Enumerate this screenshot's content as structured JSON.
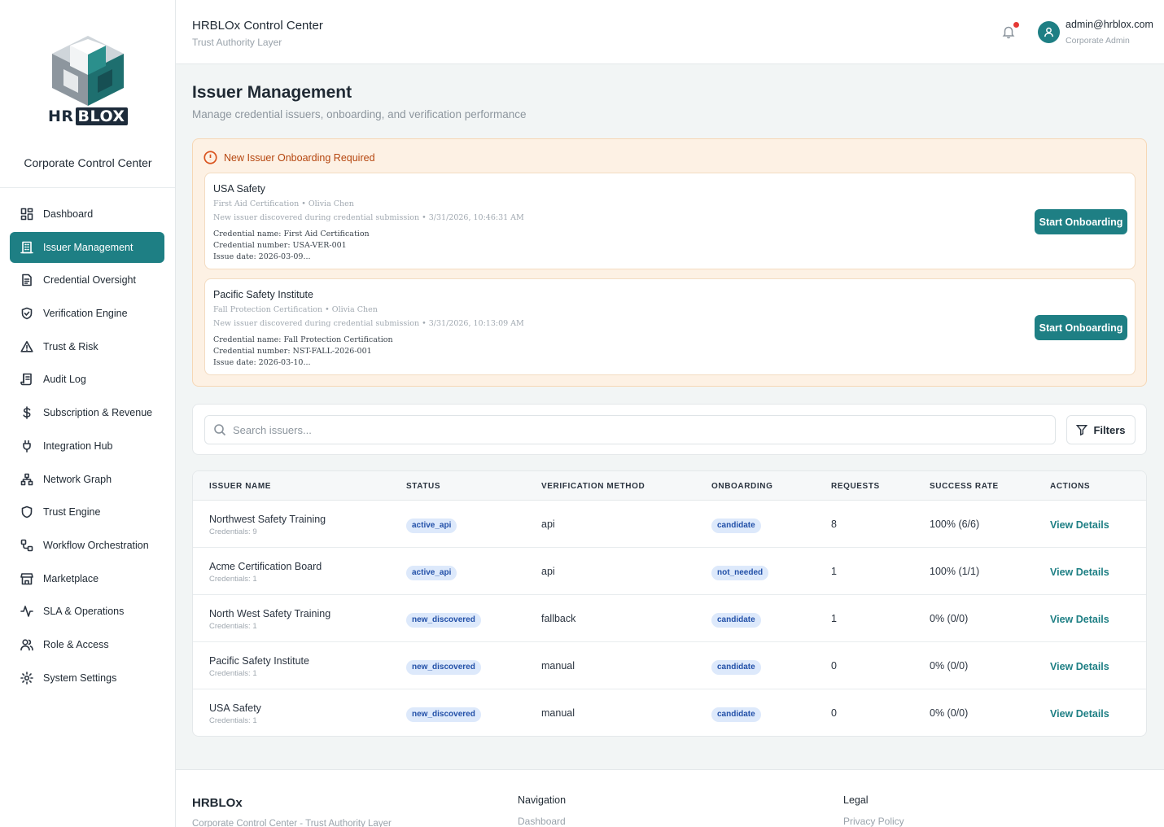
{
  "brand": {
    "logo_text_a": "HR",
    "logo_text_b": "BLOX",
    "sidebar_subtitle": "Corporate Control Center"
  },
  "sidebar": {
    "items": [
      {
        "label": "Dashboard",
        "icon": "grid-icon"
      },
      {
        "label": "Issuer Management",
        "icon": "building-icon",
        "active": true
      },
      {
        "label": "Credential Oversight",
        "icon": "document-icon"
      },
      {
        "label": "Verification Engine",
        "icon": "shield-check-icon"
      },
      {
        "label": "Trust & Risk",
        "icon": "warning-icon"
      },
      {
        "label": "Audit Log",
        "icon": "scroll-icon"
      },
      {
        "label": "Subscription & Revenue",
        "icon": "dollar-icon"
      },
      {
        "label": "Integration Hub",
        "icon": "plug-icon"
      },
      {
        "label": "Network Graph",
        "icon": "network-icon"
      },
      {
        "label": "Trust Engine",
        "icon": "shield-icon"
      },
      {
        "label": "Workflow Orchestration",
        "icon": "workflow-icon"
      },
      {
        "label": "Marketplace",
        "icon": "store-icon"
      },
      {
        "label": "SLA & Operations",
        "icon": "activity-icon"
      },
      {
        "label": "Role & Access",
        "icon": "users-icon"
      },
      {
        "label": "System Settings",
        "icon": "gear-icon"
      }
    ]
  },
  "header": {
    "title": "HRBLOx Control Center",
    "subtitle": "Trust Authority Layer",
    "user_email": "admin@hrblox.com",
    "user_role": "Corporate Admin"
  },
  "page": {
    "title": "Issuer Management",
    "subtitle": "Manage credential issuers, onboarding, and verification performance"
  },
  "alert": {
    "heading": "New Issuer Onboarding Required",
    "button_label": "Start Onboarding",
    "issuers": [
      {
        "name": "USA Safety",
        "meta": "First Aid Certification • Olivia Chen",
        "discovered": "New issuer discovered during credential submission • 3/31/2026, 10:46:31 AM",
        "credential_name": "Credential name: First Aid Certification",
        "credential_number": "Credential number: USA-VER-001",
        "issue_date": "Issue date: 2026-03-09..."
      },
      {
        "name": "Pacific Safety Institute",
        "meta": "Fall Protection Certification • Olivia Chen",
        "discovered": "New issuer discovered during credential submission • 3/31/2026, 10:13:09 AM",
        "credential_name": "Credential name: Fall Protection Certification",
        "credential_number": "Credential number: NST-FALL-2026-001",
        "issue_date": "Issue date: 2026-03-10..."
      }
    ]
  },
  "search": {
    "placeholder": "Search issuers...",
    "filters_label": "Filters"
  },
  "table": {
    "headers": [
      "ISSUER NAME",
      "STATUS",
      "VERIFICATION METHOD",
      "ONBOARDING",
      "REQUESTS",
      "SUCCESS RATE",
      "ACTIONS"
    ],
    "action_label": "View Details",
    "rows": [
      {
        "name": "Northwest Safety Training",
        "credentials": "Credentials: 9",
        "status": "active_api",
        "method": "api",
        "onboarding": "candidate",
        "requests": "8",
        "success": "100% (6/6)"
      },
      {
        "name": "Acme Certification Board",
        "credentials": "Credentials: 1",
        "status": "active_api",
        "method": "api",
        "onboarding": "not_needed",
        "requests": "1",
        "success": "100% (1/1)"
      },
      {
        "name": "North West Safety Training",
        "credentials": "Credentials: 1",
        "status": "new_discovered",
        "method": "fallback",
        "onboarding": "candidate",
        "requests": "1",
        "success": "0% (0/0)"
      },
      {
        "name": "Pacific Safety Institute",
        "credentials": "Credentials: 1",
        "status": "new_discovered",
        "method": "manual",
        "onboarding": "candidate",
        "requests": "0",
        "success": "0% (0/0)"
      },
      {
        "name": "USA Safety",
        "credentials": "Credentials: 1",
        "status": "new_discovered",
        "method": "manual",
        "onboarding": "candidate",
        "requests": "0",
        "success": "0% (0/0)"
      }
    ]
  },
  "footer": {
    "brand": "HRBLOx",
    "tagline": "Corporate Control Center - Trust Authority Layer",
    "nav_heading": "Navigation",
    "nav_link": "Dashboard",
    "legal_heading": "Legal",
    "legal_link": "Privacy Policy"
  },
  "colors": {
    "accent": "#1e7f84",
    "alert_bg": "#fdf1e4",
    "alert_text": "#b5460f",
    "badge_bg": "#dde9fb",
    "badge_text": "#2250a8"
  }
}
